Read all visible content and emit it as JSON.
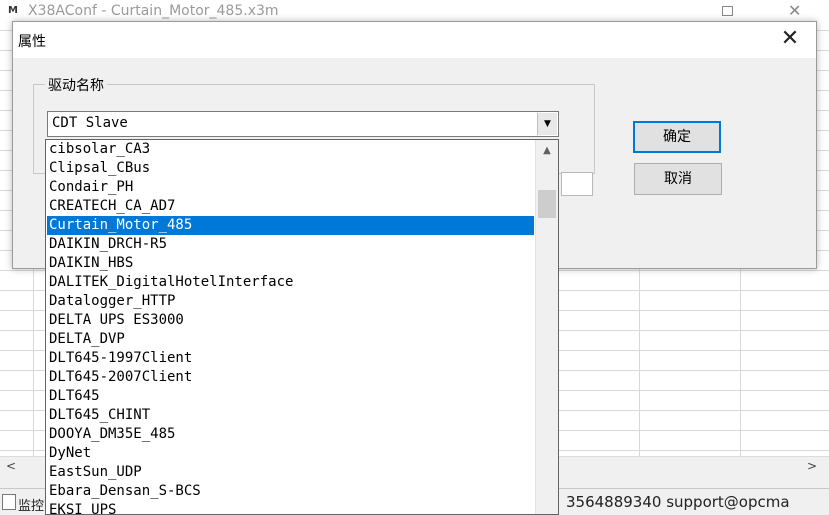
{
  "main_window": {
    "title": "X38AConf - Curtain_Motor_485.x3m"
  },
  "status_bar": {
    "label": "监控",
    "contact": "3564889340 support@opcma"
  },
  "dialog": {
    "title": "属性",
    "group_label": "驱动名称",
    "combo_value": "CDT Slave",
    "ok_label": "确定",
    "cancel_label": "取消"
  },
  "dropdown": {
    "items": [
      "cibsolar_CA3",
      "Clipsal_CBus",
      "Condair_PH",
      "CREATECH_CA_AD7",
      "Curtain_Motor_485",
      "DAIKIN_DRCH-R5",
      "DAIKIN_HBS",
      "DALITEK_DigitalHotelInterface",
      "Datalogger_HTTP",
      "DELTA UPS ES3000",
      "DELTA_DVP",
      "DLT645-1997Client",
      "DLT645-2007Client",
      "DLT645",
      "DLT645_CHINT",
      "DOOYA_DM35E_485",
      "DyNet",
      "EastSun_UDP",
      "Ebara_Densan_S-BCS",
      "EKSI_UPS"
    ],
    "selected_index": 4
  },
  "colors": {
    "selection": "#0078d7",
    "dialog_bg": "#f0f0f0"
  },
  "icons": {
    "close": "close-icon",
    "combo_arrow": "chevron-down-icon",
    "scroll_up": "chevron-up-icon"
  }
}
